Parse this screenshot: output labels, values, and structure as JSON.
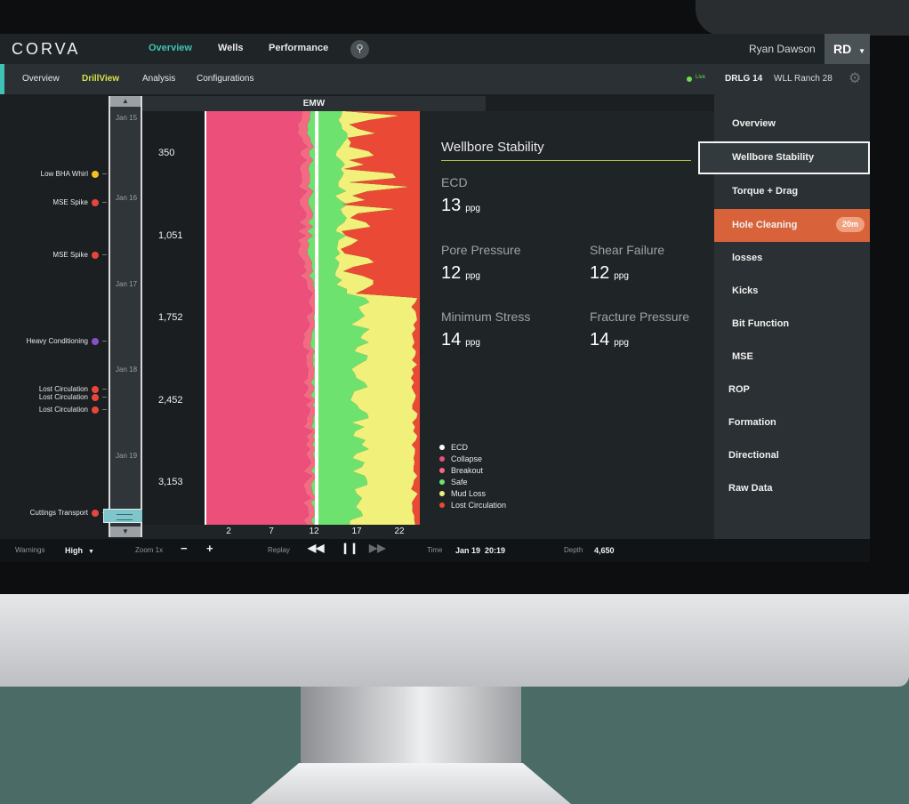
{
  "app": {
    "logo": "CORVA"
  },
  "topnav": {
    "items": [
      "Overview",
      "Wells",
      "Performance"
    ],
    "active": 0
  },
  "user": {
    "name": "Ryan Dawson",
    "initials": "RD"
  },
  "subnav": {
    "items": [
      "Overview",
      "DrillView",
      "Analysis",
      "Configurations"
    ],
    "active": 1
  },
  "status": {
    "live_label": "Live",
    "rig": "DRLG 14",
    "well": "WLL Ranch 28"
  },
  "timeline": {
    "dates": [
      "Jan 15",
      "Jan 16",
      "Jan 17",
      "Jan 18",
      "Jan 19"
    ],
    "events": [
      {
        "label": "Low BHA Whirl",
        "color": "#f3c21c"
      },
      {
        "label": "MSE Spike",
        "color": "#e8453c"
      },
      {
        "label": "MSE Spike",
        "color": "#e8453c"
      },
      {
        "label": "Heavy Conditioning",
        "color": "#8a4fc7"
      },
      {
        "label": "Lost Circulation",
        "color": "#e8453c"
      },
      {
        "label": "Lost Circulation",
        "color": "#e8453c"
      },
      {
        "label": "Lost Circulation",
        "color": "#e8453c"
      },
      {
        "label": "Cuttings Transport",
        "color": "#e8453c"
      }
    ]
  },
  "depth": {
    "labels": [
      "350",
      "1,051",
      "1,752",
      "2,452",
      "3,153"
    ]
  },
  "chart_data": {
    "type": "area",
    "title": "EMW",
    "x_ticks": [
      "2",
      "7",
      "12",
      "17",
      "22"
    ],
    "xlim": [
      0,
      24
    ],
    "ecd_value": 12.5,
    "colors": {
      "collapse": "#ec4f7a",
      "breakout": "#f46a83",
      "safe": "#6ee26f",
      "mud_loss": "#f0f07a",
      "lost_circulation": "#ea4a35",
      "ecd": "#ffffff"
    }
  },
  "panel": {
    "title": "Wellbore Stability",
    "metrics": {
      "ecd": {
        "label": "ECD",
        "value": "13",
        "unit": "ppg"
      },
      "pore": {
        "label": "Pore Pressure",
        "value": "12",
        "unit": "ppg"
      },
      "shear": {
        "label": "Shear Failure",
        "value": "12",
        "unit": "ppg"
      },
      "min_stress": {
        "label": "Minimum Stress",
        "value": "14",
        "unit": "ppg"
      },
      "fracture": {
        "label": "Fracture Pressure",
        "value": "14",
        "unit": "ppg"
      }
    },
    "legend": [
      {
        "label": "ECD",
        "color": "#ffffff"
      },
      {
        "label": "Collapse",
        "color": "#ec4f7a"
      },
      {
        "label": "Breakout",
        "color": "#f46a83"
      },
      {
        "label": "Safe",
        "color": "#6ee26f"
      },
      {
        "label": "Mud Loss",
        "color": "#f0f07a"
      },
      {
        "label": "Lost Circulation",
        "color": "#ea4a35"
      }
    ]
  },
  "menu": {
    "items": [
      "Overview",
      "Wellbore Stability",
      "Torque + Drag",
      "Hole Cleaning",
      "losses",
      "Kicks",
      "Bit Function",
      "MSE",
      "ROP",
      "Formation",
      "Directional",
      "Raw Data"
    ],
    "selected": 1,
    "highlighted": 3,
    "badge": "20m"
  },
  "bottombar": {
    "warnings_label": "Warnings",
    "warnings_value": "High",
    "zoom_label": "Zoom 1x",
    "minus": "−",
    "plus": "+",
    "replay_label": "Replay",
    "time_label": "Time",
    "time_value": "Jan 19  20:19",
    "depth_label": "Depth",
    "depth_value": "4,650"
  }
}
